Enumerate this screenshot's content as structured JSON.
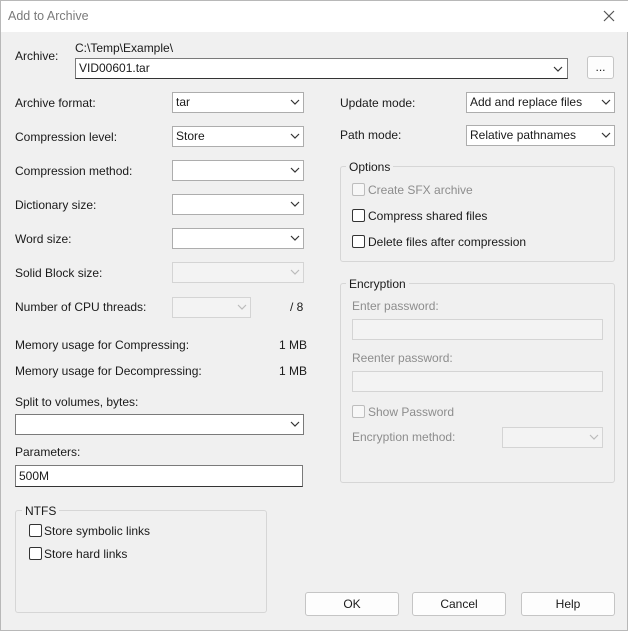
{
  "window": {
    "title": "Add to Archive",
    "close_icon": "close-icon"
  },
  "archive": {
    "label": "Archive:",
    "path": "C:\\Temp\\Example\\",
    "filename": "VID00601.tar",
    "browse_label": "..."
  },
  "left": {
    "archive_format": {
      "label": "Archive format:",
      "value": "tar"
    },
    "compression_level": {
      "label": "Compression level:",
      "value": "Store"
    },
    "compression_method": {
      "label": "Compression method:",
      "value": ""
    },
    "dictionary_size": {
      "label": "Dictionary size:",
      "value": ""
    },
    "word_size": {
      "label": "Word size:",
      "value": ""
    },
    "solid_block_size": {
      "label": "Solid Block size:",
      "value": ""
    },
    "cpu_threads": {
      "label": "Number of CPU threads:",
      "value": "",
      "total": "/ 8"
    },
    "mem_compress": {
      "label": "Memory usage for Compressing:",
      "value": "1 MB"
    },
    "mem_decompress": {
      "label": "Memory usage for Decompressing:",
      "value": "1 MB"
    },
    "split": {
      "label": "Split to volumes, bytes:",
      "value": ""
    },
    "parameters": {
      "label": "Parameters:",
      "value": "500M"
    }
  },
  "ntfs": {
    "title": "NTFS",
    "store_symlinks": {
      "label": "Store symbolic links",
      "checked": false
    },
    "store_hardlinks": {
      "label": "Store hard links",
      "checked": false
    }
  },
  "right": {
    "update_mode": {
      "label": "Update mode:",
      "value": "Add and replace files"
    },
    "path_mode": {
      "label": "Path mode:",
      "value": "Relative pathnames"
    }
  },
  "options": {
    "title": "Options",
    "create_sfx": {
      "label": "Create SFX archive",
      "checked": false,
      "enabled": false
    },
    "compress_shared": {
      "label": "Compress shared files",
      "checked": false
    },
    "delete_after": {
      "label": "Delete files after compression",
      "checked": false
    }
  },
  "encryption": {
    "title": "Encryption",
    "enter_password": {
      "label": "Enter password:",
      "value": ""
    },
    "reenter_password": {
      "label": "Reenter password:",
      "value": ""
    },
    "show_password": {
      "label": "Show Password",
      "checked": false
    },
    "method": {
      "label": "Encryption method:",
      "value": ""
    }
  },
  "buttons": {
    "ok": "OK",
    "cancel": "Cancel",
    "help": "Help"
  },
  "colors": {
    "border": "#adadad",
    "disabled_text": "#8d8d8d",
    "window_bg": "#f0f0f0"
  }
}
